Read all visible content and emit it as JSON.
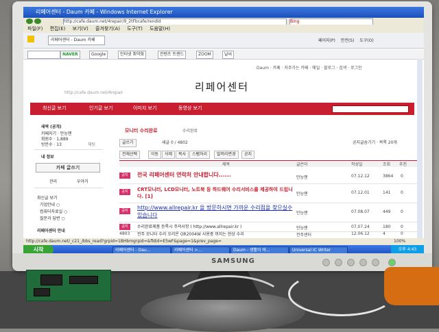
{
  "window": {
    "title": "리페어센터 - Daum 카페 - Windows Internet Explorer",
    "address": "http://cafe.daum.net/4repair/9_2tFbcafe/rendid",
    "search_placeholder": "Bing"
  },
  "menu": [
    "파일(F)",
    "편집(E)",
    "보기(V)",
    "즐겨찾기(A)",
    "도구(T)",
    "도움말(H)"
  ],
  "favorites": {
    "tab_label": "리페어센터 - Daum 카페",
    "ie_menu": [
      "페이지(P)",
      "안전(S)",
      "도구(O)"
    ]
  },
  "toolbar": {
    "items": [
      "NAVER",
      "Google",
      "인터넷 취약화",
      "컨텐츠 트랜드",
      "ZOOM",
      "날씨"
    ]
  },
  "site": {
    "toplinks": "Daum · 카페 · 자주가는 카페 · 메일 · 블로그 · 검색 · 로그인",
    "title": "리페어센터",
    "url_line": "http://cafe.daum.net/4repair",
    "nav": [
      "최신글 보기",
      "인기글 보기",
      "이미지 보기",
      "동영상 보기"
    ]
  },
  "sidebar": {
    "rank": "새싹 (공개)",
    "founder": "카페지기 · 만능맨",
    "members": "회원수 · 1,889",
    "visits": "방문수 · 13",
    "chat": "채팅",
    "my_info": "내 정보",
    "write_button": "카페 글쓰기",
    "links": [
      "관리",
      "우야거"
    ],
    "menu_items": [
      "최신글 보기",
      "기업안내 ○",
      "컴퓨터자료실 ○",
      "질문과 답변 ○"
    ],
    "footer_item": "리페어센터 안내"
  },
  "board": {
    "name": "모니터 수리완료",
    "sub": "수리완료",
    "write": "글쓰기",
    "count": "새글 0 / 4802",
    "controls": "공지글숨기기 · 목록 20개",
    "actions": [
      "전체선택",
      "이동",
      "삭제",
      "복사",
      "스팸처리",
      "말머리변경",
      "공지"
    ],
    "columns": [
      "제목",
      "글쓴이",
      "작성일",
      "조회",
      "추천"
    ],
    "rows": [
      {
        "badge": "공지",
        "subject": "전국 리페어센터 연락처 안내합니다......",
        "author": "만능맨",
        "date": "07.12.12",
        "views": "3864",
        "rec": "0",
        "style": "red"
      },
      {
        "badge": "공지",
        "subject": "CRT모니터, LCD모니터, 노트북 등 하드웨어 수리서비스를 제공하여 드립니다. [1]",
        "author": "만능맨",
        "date": "07.12.01",
        "views": "141",
        "rec": "0",
        "style": "red"
      },
      {
        "badge": "공지",
        "subject": "http://www.allrepair.kr 을 방문하시면 가까운 수리점을 찾으실수 있습니다",
        "author": "만능맨",
        "date": "07.08.07",
        "views": "449",
        "rec": "0",
        "style": "blue"
      },
      {
        "badge": "공지",
        "subject": "수리완료제품 등록시 주의사항 ( http://www.allrepair.kr )",
        "author": "만능맨",
        "date": "07.07.24",
        "views": "180",
        "rec": "0",
        "style": "gray"
      },
      {
        "badge": "4803",
        "subject": "전주 모니터 수리 오리온 OR2004W 사용중 꺼지는 현상 수리",
        "author": "전주센터",
        "date": "12.06.12",
        "views": "4",
        "rec": "0",
        "style": "gray"
      }
    ]
  },
  "status": {
    "left": "http://cafe.daum.net/_c21_/bbs_read?grpid=1BHbmgrpid=&fldid=E5wF&page=1&prev_page=",
    "zoom": "100%"
  },
  "taskbar": {
    "start": "시작",
    "tasks": [
      "리페어센터 - Dau...",
      "리페어센터 >...",
      "Daum - 생활이 바...",
      "Universal IC Writer"
    ],
    "clock": "오후 4:43"
  },
  "hardware": {
    "brand": "SAMSUNG"
  }
}
